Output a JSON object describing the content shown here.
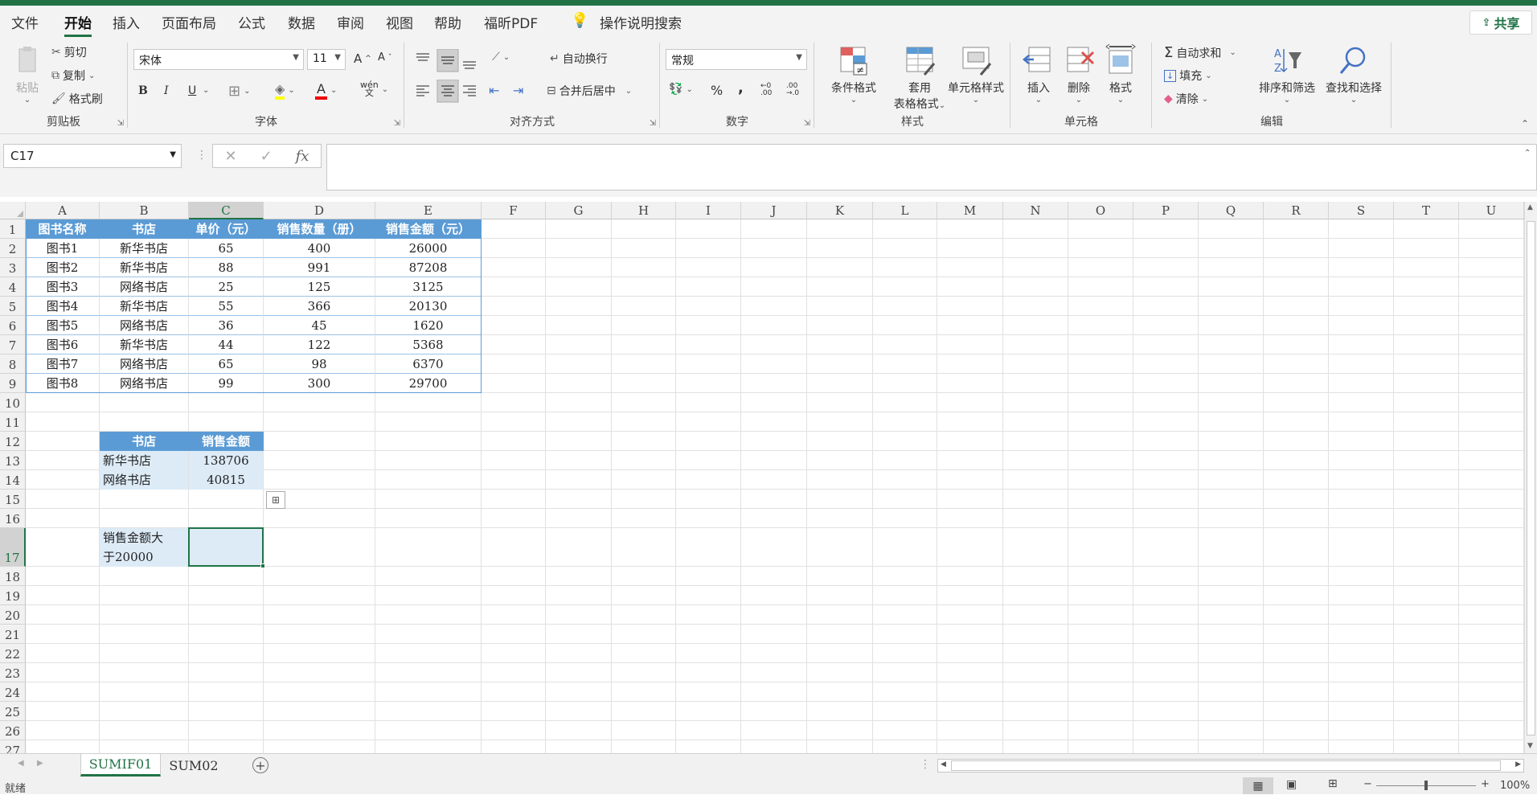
{
  "menu": {
    "items": [
      "文件",
      "开始",
      "插入",
      "页面布局",
      "公式",
      "数据",
      "审阅",
      "视图",
      "帮助",
      "福昕PDF"
    ],
    "search": "操作说明搜索",
    "share": "共享"
  },
  "ribbon": {
    "clipboard": {
      "paste": "粘贴",
      "cut": "剪切",
      "copy": "复制",
      "format_painter": "格式刷",
      "label": "剪贴板"
    },
    "font": {
      "name": "宋体",
      "size": "11",
      "bold": "B",
      "italic": "I",
      "underline": "U",
      "phonetic": "wén",
      "label": "字体"
    },
    "align": {
      "wrap": "自动换行",
      "merge": "合并后居中",
      "label": "对齐方式"
    },
    "number": {
      "format": "常规",
      "percent": "%",
      "comma": ",",
      "label": "数字"
    },
    "styles": {
      "cond": "条件格式",
      "table_line1": "套用",
      "table_line2": "表格格式",
      "cell_style": "单元格样式",
      "label": "样式"
    },
    "cells": {
      "insert": "插入",
      "delete": "删除",
      "format": "格式",
      "label": "单元格"
    },
    "edit": {
      "autosum": "自动求和",
      "fill": "填充",
      "clear": "清除",
      "sort": "排序和筛选",
      "find": "查找和选择",
      "label": "编辑"
    }
  },
  "formula": {
    "namebox": "C17",
    "fx": "fx",
    "value": ""
  },
  "columns": [
    "A",
    "B",
    "C",
    "D",
    "E",
    "F",
    "G",
    "H",
    "I",
    "J",
    "K",
    "L",
    "M",
    "N",
    "O",
    "P",
    "Q",
    "R",
    "S",
    "T",
    "U"
  ],
  "rows": [
    "1",
    "2",
    "3",
    "4",
    "5",
    "6",
    "7",
    "8",
    "9",
    "10",
    "11",
    "12",
    "13",
    "14",
    "15",
    "16",
    "17",
    "18",
    "19",
    "20",
    "21",
    "22",
    "23",
    "24",
    "25",
    "26",
    "27"
  ],
  "table": {
    "headers": [
      "图书名称",
      "书店",
      "单价（元）",
      "销售数量（册）",
      "销售金额（元）"
    ],
    "rows": [
      [
        "图书1",
        "新华书店",
        "65",
        "400",
        "26000"
      ],
      [
        "图书2",
        "新华书店",
        "88",
        "991",
        "87208"
      ],
      [
        "图书3",
        "网络书店",
        "25",
        "125",
        "3125"
      ],
      [
        "图书4",
        "新华书店",
        "55",
        "366",
        "20130"
      ],
      [
        "图书5",
        "网络书店",
        "36",
        "45",
        "1620"
      ],
      [
        "图书6",
        "新华书店",
        "44",
        "122",
        "5368"
      ],
      [
        "图书7",
        "网络书店",
        "65",
        "98",
        "6370"
      ],
      [
        "图书8",
        "网络书店",
        "99",
        "300",
        "29700"
      ]
    ]
  },
  "summary": {
    "headers": [
      "书店",
      "销售金额"
    ],
    "rows": [
      [
        "新华书店",
        "138706"
      ],
      [
        "网络书店",
        "40815"
      ]
    ]
  },
  "condition": {
    "line1": "销售金额大",
    "line2": "于20000"
  },
  "sheets": [
    "SUMIF01",
    "SUM02"
  ],
  "status": {
    "left": "就绪",
    "zoom": "100%"
  },
  "colors": {
    "accent": "#217346",
    "table_header": "#5b9bd5",
    "table_light": "#ddebf7"
  }
}
